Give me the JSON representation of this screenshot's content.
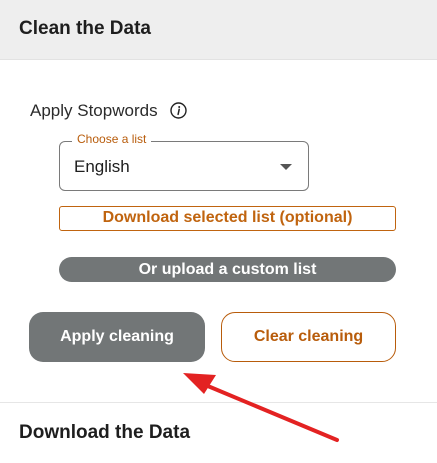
{
  "header": {
    "title": "Clean the Data"
  },
  "stopwords": {
    "label": "Apply Stopwords",
    "info_icon": "info-icon",
    "select": {
      "legend": "Choose a list",
      "value": "English",
      "caret_icon": "chevron-down-icon"
    },
    "download_list_label": "Download selected list (optional)",
    "upload_label": "Or upload a custom list"
  },
  "actions": {
    "apply_label": "Apply cleaning",
    "clear_label": "Clear cleaning"
  },
  "download_section": {
    "title": "Download the Data"
  },
  "annotation": {
    "icon": "red-arrow-icon",
    "color": "#e32222"
  },
  "colors": {
    "accent": "#b85c0b",
    "button_gray": "#727677",
    "header_bg": "#eeeeee"
  }
}
